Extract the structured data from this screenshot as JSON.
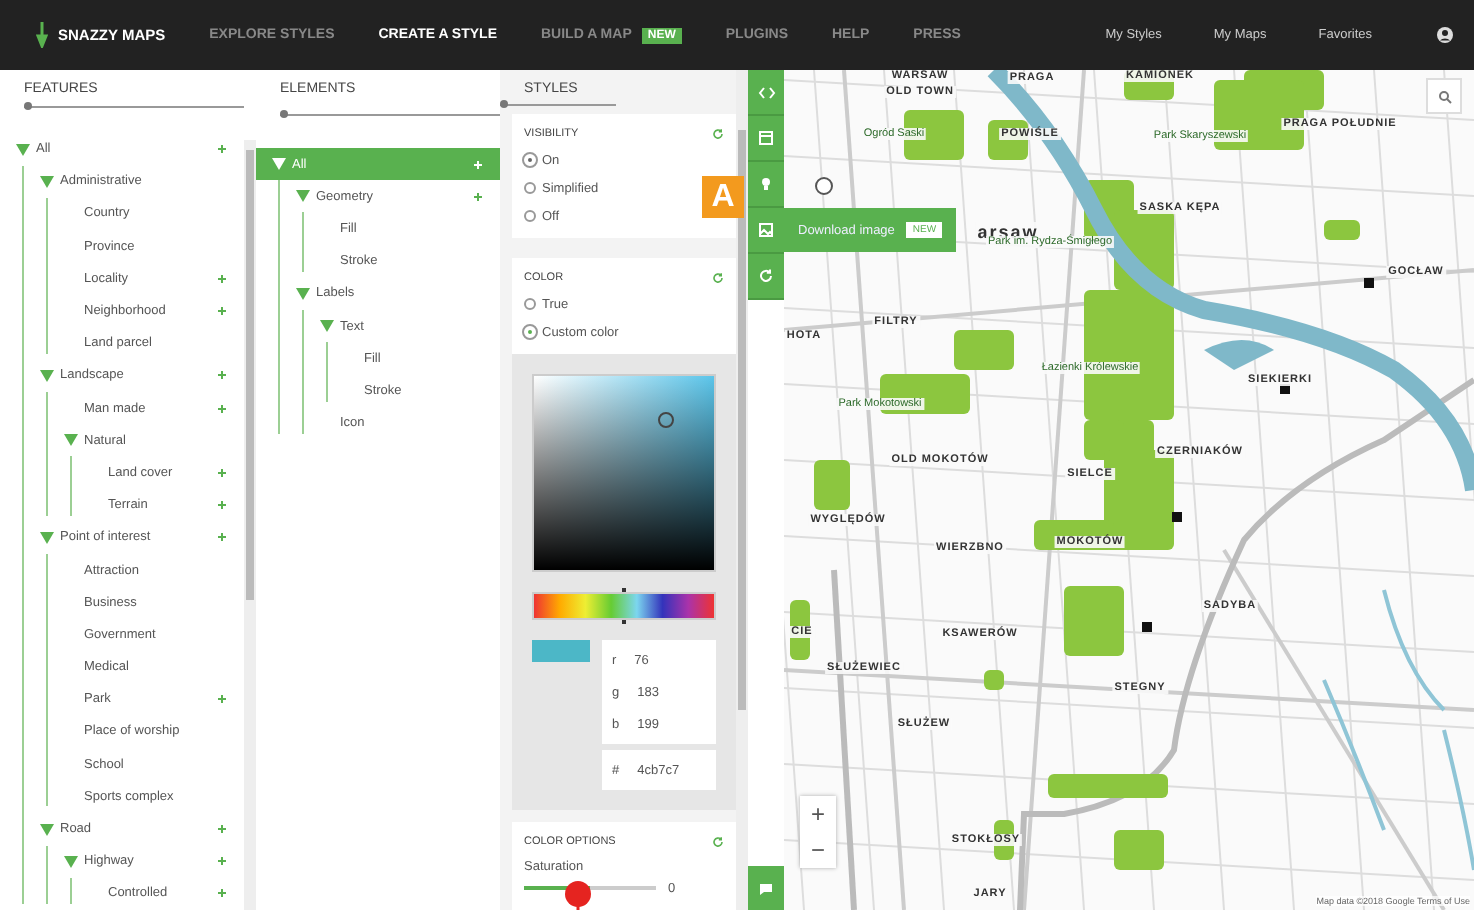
{
  "header": {
    "logo": "SNAZZY MAPS",
    "nav": [
      {
        "label": "EXPLORE STYLES",
        "selected": false
      },
      {
        "label": "CREATE A STYLE",
        "selected": true
      },
      {
        "label": "BUILD A MAP",
        "selected": false,
        "badge": "NEW"
      },
      {
        "label": "PLUGINS",
        "selected": false
      },
      {
        "label": "HELP",
        "selected": false
      },
      {
        "label": "PRESS",
        "selected": false
      }
    ],
    "links": [
      "My Styles",
      "My Maps",
      "Favorites"
    ]
  },
  "features": {
    "title": "FEATURES",
    "items": [
      {
        "label": "All",
        "styled": true,
        "expanded": true,
        "children": [
          {
            "label": "Administrative",
            "styled": false,
            "expanded": true,
            "children": [
              {
                "label": "Country",
                "styled": false
              },
              {
                "label": "Province",
                "styled": false
              },
              {
                "label": "Locality",
                "styled": true
              },
              {
                "label": "Neighborhood",
                "styled": true
              },
              {
                "label": "Land parcel",
                "styled": false
              }
            ]
          },
          {
            "label": "Landscape",
            "styled": true,
            "expanded": true,
            "children": [
              {
                "label": "Man made",
                "styled": true
              },
              {
                "label": "Natural",
                "styled": false,
                "expanded": true,
                "children": [
                  {
                    "label": "Land cover",
                    "styled": true
                  },
                  {
                    "label": "Terrain",
                    "styled": true
                  }
                ]
              }
            ]
          },
          {
            "label": "Point of interest",
            "styled": true,
            "expanded": true,
            "children": [
              {
                "label": "Attraction",
                "styled": false
              },
              {
                "label": "Business",
                "styled": false
              },
              {
                "label": "Government",
                "styled": false
              },
              {
                "label": "Medical",
                "styled": false
              },
              {
                "label": "Park",
                "styled": true
              },
              {
                "label": "Place of worship",
                "styled": false
              },
              {
                "label": "School",
                "styled": false
              },
              {
                "label": "Sports complex",
                "styled": false
              }
            ]
          },
          {
            "label": "Road",
            "styled": true,
            "expanded": true,
            "children": [
              {
                "label": "Highway",
                "styled": true,
                "expanded": true,
                "children": [
                  {
                    "label": "Controlled",
                    "styled": true
                  }
                ]
              }
            ]
          }
        ]
      }
    ]
  },
  "elements": {
    "title": "ELEMENTS",
    "items": [
      {
        "label": "All",
        "styled": true,
        "selected": true,
        "expanded": true,
        "children": [
          {
            "label": "Geometry",
            "styled": true,
            "selected": false,
            "expanded": true,
            "children": [
              {
                "label": "Fill",
                "styled": false,
                "selected": false
              },
              {
                "label": "Stroke",
                "styled": false,
                "selected": false
              }
            ]
          },
          {
            "label": "Labels",
            "styled": false,
            "selected": false,
            "expanded": true,
            "children": [
              {
                "label": "Text",
                "styled": false,
                "selected": false,
                "expanded": true,
                "children": [
                  {
                    "label": "Fill",
                    "styled": false,
                    "selected": false
                  },
                  {
                    "label": "Stroke",
                    "styled": false,
                    "selected": false
                  }
                ]
              },
              {
                "label": "Icon",
                "styled": false,
                "selected": false
              }
            ]
          }
        ]
      }
    ]
  },
  "styles": {
    "title": "STYLES",
    "visibility": {
      "title": "VISIBILITY",
      "options": [
        {
          "label": "On",
          "selected": true
        },
        {
          "label": "Simplified",
          "selected": false
        },
        {
          "label": "Off",
          "selected": false
        }
      ]
    },
    "color": {
      "title": "COLOR",
      "options": [
        {
          "label": "True",
          "selected": false
        },
        {
          "label": "Custom color",
          "selected": true
        }
      ],
      "picker": {
        "hue": {
          "level": 0.5
        },
        "r_label": "r",
        "r": "76",
        "g_label": "g",
        "g": "183",
        "b_label": "b",
        "b": "199",
        "hex_label": "#",
        "hex": "4cb7c7"
      }
    },
    "color_options": {
      "title": "COLOR OPTIONS",
      "slider": {
        "label": "Saturation",
        "level": 0.5,
        "reading": "0"
      }
    }
  },
  "callout": "A",
  "toolbar": [
    {
      "kind": "code"
    },
    {
      "kind": "box"
    },
    {
      "kind": "bulb"
    },
    {
      "kind": "image",
      "tooltip": "Download image",
      "badge": "NEW"
    },
    {
      "kind": "refresh"
    }
  ],
  "map": {
    "labels": [
      {
        "text": "WARSAW",
        "kind": "district"
      },
      {
        "text": "OLD TOWN",
        "kind": "district"
      },
      {
        "text": "PRAGA",
        "kind": "district"
      },
      {
        "text": "KAMIONEK",
        "kind": "district"
      },
      {
        "text": "Park Skaryszewski",
        "kind": "park"
      },
      {
        "text": "PRAGA POŁUDNIE",
        "kind": "district"
      },
      {
        "text": "Ogród Saski",
        "kind": "park"
      },
      {
        "text": "POWIŚLE",
        "kind": "district"
      },
      {
        "text": "SASKA KĘPA",
        "kind": "district"
      },
      {
        "text": "arsaw",
        "kind": "city"
      },
      {
        "text": "Park im. Rydza-Śmigłego",
        "kind": "park"
      },
      {
        "text": "GOCŁAW",
        "kind": "district"
      },
      {
        "text": "FILTRY",
        "kind": "district"
      },
      {
        "text": "HOTA",
        "kind": "district"
      },
      {
        "text": "Łazienki Królewskie",
        "kind": "park"
      },
      {
        "text": "Park Mokotowski",
        "kind": "park"
      },
      {
        "text": "SIEKIERKI",
        "kind": "district"
      },
      {
        "text": "OLD MOKOTÓW",
        "kind": "district"
      },
      {
        "text": "SIELCE",
        "kind": "district"
      },
      {
        "text": "CZERNIAKÓW",
        "kind": "district"
      },
      {
        "text": "WYGLĘDÓW",
        "kind": "district"
      },
      {
        "text": "WIERZBNO",
        "kind": "district"
      },
      {
        "text": "MOKOTÓW",
        "kind": "district"
      },
      {
        "text": "SADYBA",
        "kind": "district"
      },
      {
        "text": "CIE",
        "kind": "district"
      },
      {
        "text": "SŁUŻEWIEC",
        "kind": "district"
      },
      {
        "text": "KSAWERÓW",
        "kind": "district"
      },
      {
        "text": "STEGNY",
        "kind": "district"
      },
      {
        "text": "SŁUŻEW",
        "kind": "district"
      },
      {
        "text": "STOKŁOSY",
        "kind": "district"
      },
      {
        "text": "JARY",
        "kind": "district"
      }
    ],
    "zoom_in": "+",
    "zoom_out": "−",
    "attribution": "Map data ©2018 Google   Terms of Use"
  }
}
